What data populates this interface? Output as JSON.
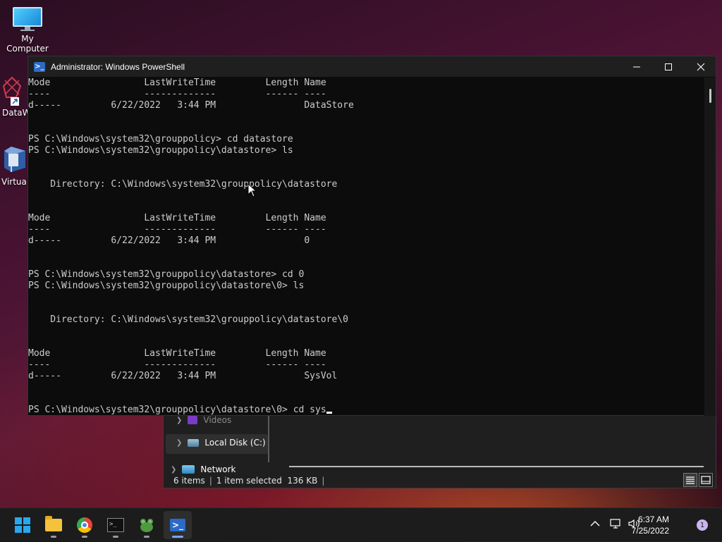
{
  "desktop": {
    "icons": [
      {
        "label": "My Computer"
      },
      {
        "label": "DataW"
      },
      {
        "label": "Virtual"
      }
    ]
  },
  "explorer": {
    "nav": {
      "videos": "Videos",
      "local_disk": "Local Disk (C:)",
      "network": "Network"
    },
    "status": {
      "items": "6 items",
      "sep": "|",
      "selected": "1 item selected  136 KB",
      "sep2": "|"
    }
  },
  "powershell": {
    "title": "Administrator: Windows PowerShell",
    "controls": {
      "minimize": "—",
      "maximize": "☐",
      "close": "✕"
    },
    "lines": [
      "Mode                 LastWriteTime         Length Name",
      "----                 -------------         ------ ----",
      "d-----         6/22/2022   3:44 PM                DataStore",
      "",
      "",
      "PS C:\\Windows\\system32\\grouppolicy> cd datastore",
      "PS C:\\Windows\\system32\\grouppolicy\\datastore> ls",
      "",
      "",
      "    Directory: C:\\Windows\\system32\\grouppolicy\\datastore",
      "",
      "",
      "Mode                 LastWriteTime         Length Name",
      "----                 -------------         ------ ----",
      "d-----         6/22/2022   3:44 PM                0",
      "",
      "",
      "PS C:\\Windows\\system32\\grouppolicy\\datastore> cd 0",
      "PS C:\\Windows\\system32\\grouppolicy\\datastore\\0> ls",
      "",
      "",
      "    Directory: C:\\Windows\\system32\\grouppolicy\\datastore\\0",
      "",
      "",
      "Mode                 LastWriteTime         Length Name",
      "----                 -------------         ------ ----",
      "d-----         6/22/2022   3:44 PM                SysVol",
      "",
      ""
    ],
    "prompt": "PS C:\\Windows\\system32\\grouppolicy\\datastore\\0> ",
    "current_input": "cd sys"
  },
  "taskbar": {
    "apps": [
      {
        "name": "start",
        "icon": "windows-logo-icon"
      },
      {
        "name": "file-explorer",
        "icon": "folder-icon"
      },
      {
        "name": "chrome",
        "icon": "chrome-icon"
      },
      {
        "name": "command-prompt",
        "icon": "cmd-icon"
      },
      {
        "name": "frog-app",
        "icon": "frog-icon"
      },
      {
        "name": "powershell",
        "icon": "powershell-icon",
        "active": true
      }
    ],
    "clock": {
      "time": "6:37 AM",
      "date": "7/25/2022"
    },
    "notification_count": "1"
  },
  "colors": {
    "terminal_bg": "#0c0c0c",
    "terminal_fg": "#cccccc",
    "titlebar": "#1f1f1f",
    "taskbar": "#1c1c1c",
    "accent": "#2aa7ef"
  }
}
